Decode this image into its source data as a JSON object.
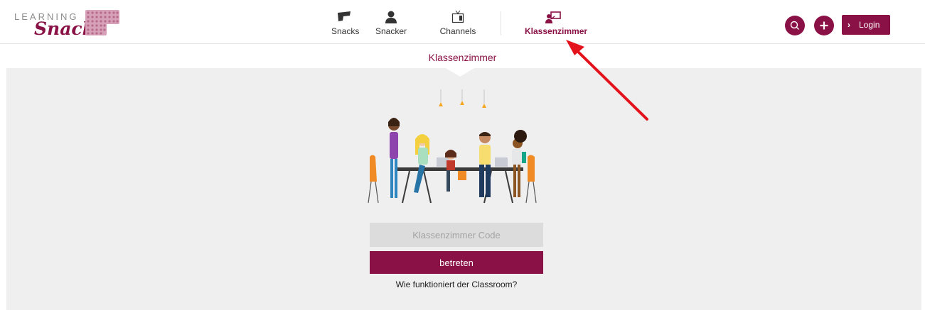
{
  "logo": {
    "line1": "LEARNING",
    "line2": "Snacks"
  },
  "nav": {
    "items": [
      {
        "label": "Snacks",
        "icon": "snack-icon"
      },
      {
        "label": "Snacker",
        "icon": "user-icon"
      },
      {
        "label": "Channels",
        "icon": "tv-icon"
      },
      {
        "label": "Klassenzimmer",
        "icon": "classroom-icon",
        "active": true
      }
    ]
  },
  "header": {
    "login_label": "Login"
  },
  "subbar": {
    "title": "Klassenzimmer"
  },
  "form": {
    "code_placeholder": "Klassenzimmer Code",
    "code_value": "",
    "submit_label": "betreten",
    "help_link": "Wie funktioniert der Classroom?"
  },
  "colors": {
    "brand": "#8a1146",
    "background": "#efefef",
    "input_bg": "#dcdcdc",
    "annotation": "#e3121b"
  }
}
